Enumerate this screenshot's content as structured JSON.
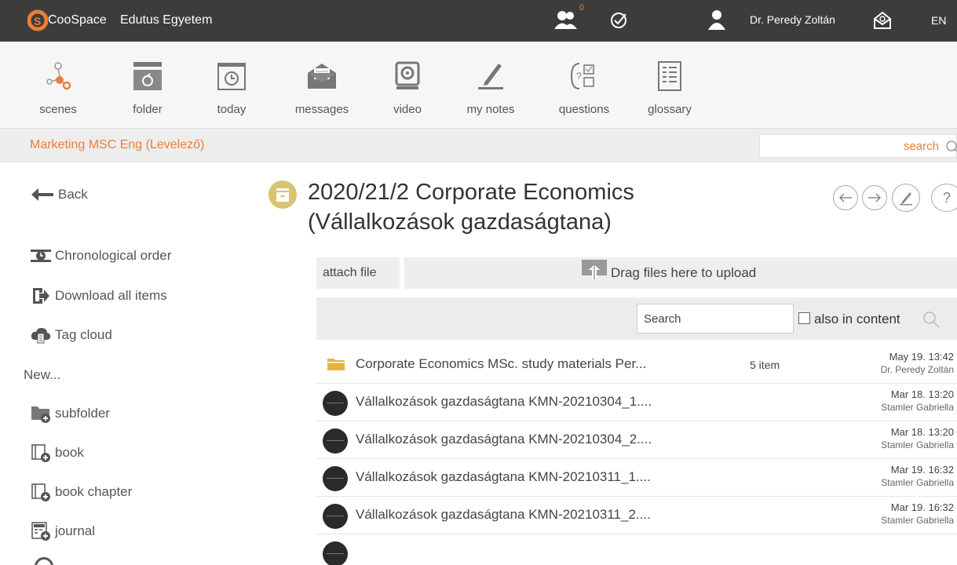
{
  "topbar": {
    "brand": "CooSpace",
    "institution": "Edutus Egyetem",
    "notification_count": "0",
    "user_name": "Dr. Peredy Zoltán",
    "language": "EN"
  },
  "tools": [
    {
      "label": "scenes",
      "icon": "scenes-icon"
    },
    {
      "label": "folder",
      "icon": "folder-icon"
    },
    {
      "label": "today",
      "icon": "calendar-icon"
    },
    {
      "label": "messages",
      "icon": "envelope-icon"
    },
    {
      "label": "video",
      "icon": "webcam-icon"
    },
    {
      "label": "my notes",
      "icon": "pencil-icon"
    },
    {
      "label": "questions",
      "icon": "questions-icon"
    },
    {
      "label": "glossary",
      "icon": "glossary-icon"
    }
  ],
  "course": {
    "name": "Marketing MSC Eng (Levelező)",
    "search_label": "search"
  },
  "sidebar": {
    "back": "Back",
    "items": [
      {
        "label": "Chronological order",
        "icon": "clock-icon"
      },
      {
        "label": "Download all items",
        "icon": "download-icon"
      },
      {
        "label": "Tag cloud",
        "icon": "tag-cloud-icon"
      }
    ],
    "new_heading": "New...",
    "new_items": [
      {
        "label": "subfolder",
        "icon": "add-subfolder-icon"
      },
      {
        "label": "book",
        "icon": "add-book-icon"
      },
      {
        "label": "book chapter",
        "icon": "add-book-chapter-icon"
      },
      {
        "label": "journal",
        "icon": "add-journal-icon"
      }
    ]
  },
  "main": {
    "title_line1": "2020/21/2 Corporate Economics",
    "title_line2": "(Vállalkozások gazdaságtana)",
    "attach_label": "attach file",
    "drop_label": "Drag files here to upload",
    "search_placeholder": "Search",
    "also_in_content": "also in content"
  },
  "files": [
    {
      "name": "Corporate Economics MSc. study materials Per...",
      "count": "5 item",
      "date": "May 19. 13:42",
      "author": "Dr. Peredy Zoltán",
      "type": "folder"
    },
    {
      "name": "Vállalkozások gazdaságtana KMN-20210304_1....",
      "count": "",
      "date": "Mar 18. 13:20",
      "author": "Stamler Gabriella",
      "type": "video"
    },
    {
      "name": "Vállalkozások gazdaságtana KMN-20210304_2....",
      "count": "",
      "date": "Mar 18. 13:20",
      "author": "Stamler Gabriella",
      "type": "video"
    },
    {
      "name": "Vállalkozások gazdaságtana KMN-20210311_1....",
      "count": "",
      "date": "Mar 19. 16:32",
      "author": "Stamler Gabriella",
      "type": "video"
    },
    {
      "name": "Vállalkozások gazdaságtana KMN-20210311_2....",
      "count": "",
      "date": "Mar 19. 16:32",
      "author": "Stamler Gabriella",
      "type": "video"
    }
  ],
  "colors": {
    "accent": "#e8803a",
    "topbar": "#3c3c3c",
    "folder": "#e8b23a"
  }
}
